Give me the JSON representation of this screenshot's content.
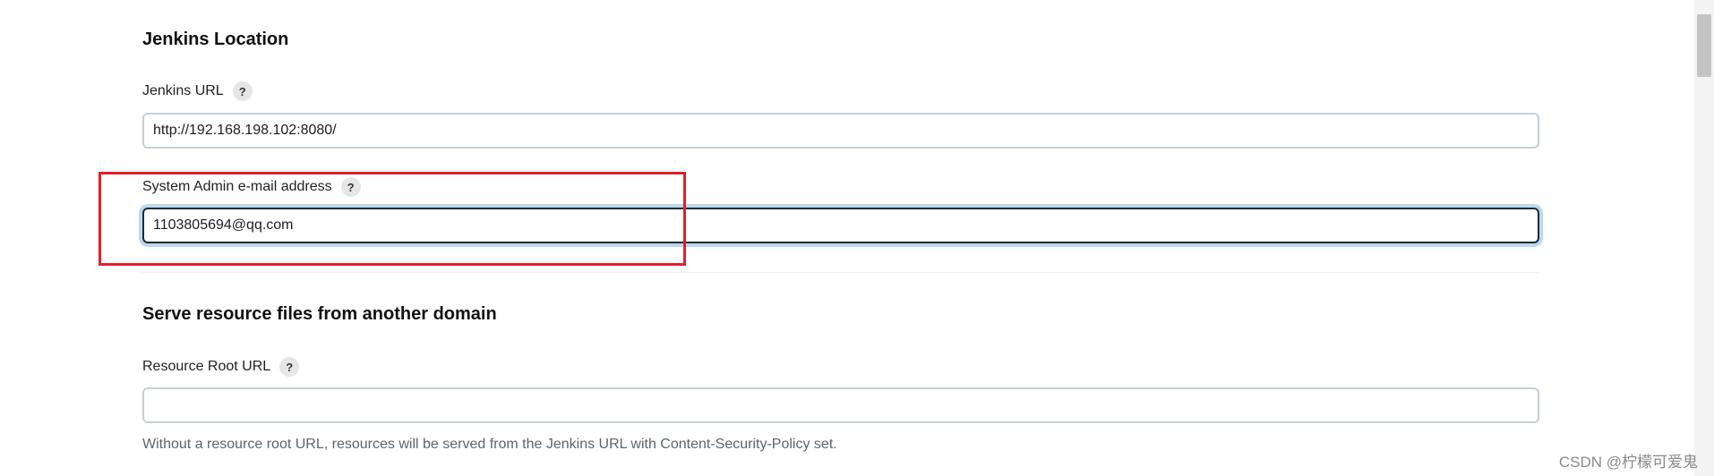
{
  "jenkins_location": {
    "title": "Jenkins Location",
    "jenkins_url": {
      "label": "Jenkins URL",
      "help": "?",
      "value": "http://192.168.198.102:8080/"
    },
    "admin_email": {
      "label": "System Admin e-mail address",
      "help": "?",
      "value": "1103805694@qq.com"
    }
  },
  "resource_domain": {
    "title": "Serve resource files from another domain",
    "resource_root_url": {
      "label": "Resource Root URL",
      "help": "?",
      "value": "",
      "description": "Without a resource root URL, resources will be served from the Jenkins URL with Content-Security-Policy set."
    }
  },
  "watermark": "CSDN @柠檬可爱鬼",
  "colors": {
    "highlight_box": "#e0202a",
    "focus_ring": "#bcd8ec",
    "input_border": "#c6d0d6"
  }
}
